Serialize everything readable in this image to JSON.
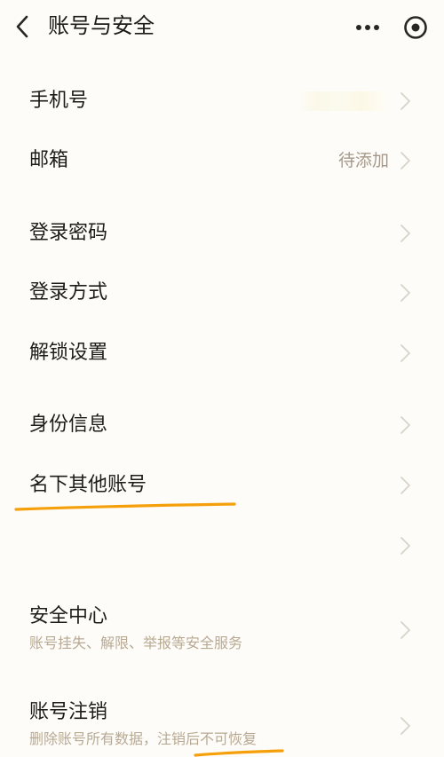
{
  "header": {
    "title": "账号与安全",
    "icons": {
      "back": "chevron-left-icon",
      "more": "more-dots-icon",
      "target": "target-icon"
    }
  },
  "rows": [
    {
      "label": "手机号",
      "value": "",
      "masked": true
    },
    {
      "label": "邮箱",
      "value": "待添加"
    },
    {
      "label": "登录密码"
    },
    {
      "label": "登录方式"
    },
    {
      "label": "解锁设置"
    },
    {
      "label": "身份信息"
    },
    {
      "label": "名下其他账号"
    },
    {
      "label": ""
    },
    {
      "label": "安全中心",
      "subtitle": "账号挂失、解限、举报等安全服务"
    },
    {
      "label": "账号注销",
      "subtitle": "删除账号所有数据，注销后不可恢复"
    }
  ],
  "colors": {
    "background": "#fefcf8",
    "text": "#1f1c18",
    "secondary_text": "#a5988a",
    "subtitle_text": "#b8a993",
    "chevron": "#d8d2c8",
    "highlight_underline": "#f5a00a"
  }
}
